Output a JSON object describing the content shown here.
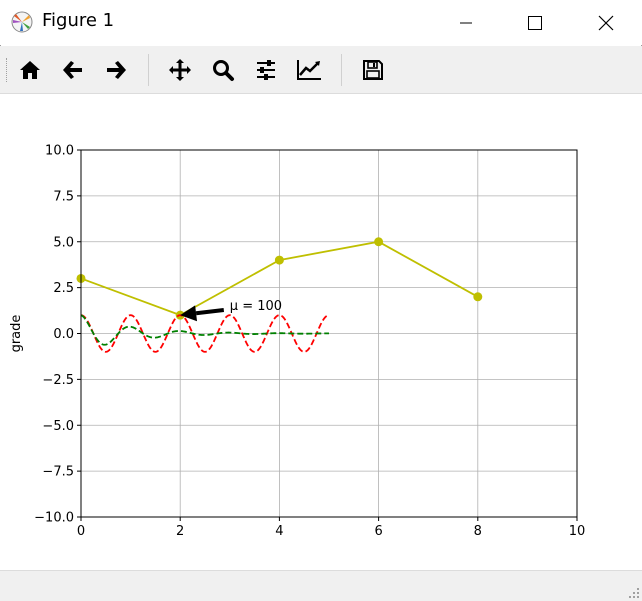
{
  "window": {
    "title": "Figure 1",
    "buttons": {
      "minimize": "minimize",
      "maximize": "maximize",
      "close": "close"
    }
  },
  "toolbar": {
    "items": [
      {
        "icon": "home-icon",
        "label": "Home"
      },
      {
        "icon": "back-arrow-icon",
        "label": "Back"
      },
      {
        "icon": "forward-arrow-icon",
        "label": "Forward"
      },
      {
        "icon": "pan-icon",
        "label": "Pan"
      },
      {
        "icon": "zoom-icon",
        "label": "Zoom"
      },
      {
        "icon": "subplots-icon",
        "label": "Configure subplots"
      },
      {
        "icon": "edit-axis-icon",
        "label": "Edit axis"
      },
      {
        "icon": "save-icon",
        "label": "Save"
      }
    ]
  },
  "chart_data": {
    "type": "line",
    "xlabel": "",
    "ylabel": "grade",
    "xlim": [
      0,
      10
    ],
    "ylim": [
      -10,
      10
    ],
    "xticks": [
      "0",
      "2",
      "4",
      "6",
      "8",
      "10"
    ],
    "yticks": [
      "10.0",
      "7.5",
      "5.0",
      "2.5",
      "0.0",
      "−2.5",
      "−5.0",
      "−7.5",
      "−10.0"
    ],
    "grid": true,
    "colors": {
      "olive": "#bfbf00",
      "red": "#ff0000",
      "green": "#008000"
    },
    "series": [
      {
        "style": "solid-markers",
        "color": "#bfbf00",
        "x": [
          0,
          2,
          4,
          6,
          8
        ],
        "y": [
          3,
          1,
          4,
          5,
          2
        ]
      },
      {
        "style": "dashed",
        "color": "#ff0000",
        "function": "cos(2*pi*x)",
        "x_range": [
          0,
          5
        ]
      },
      {
        "style": "dashed",
        "color": "#008000",
        "function": "exp(-x)*cos(2*pi*x)",
        "x_range": [
          0,
          5
        ]
      }
    ],
    "annotation": {
      "text": "μ = 100",
      "xy": [
        2,
        1
      ],
      "xytext": [
        3,
        1.5
      ]
    }
  }
}
